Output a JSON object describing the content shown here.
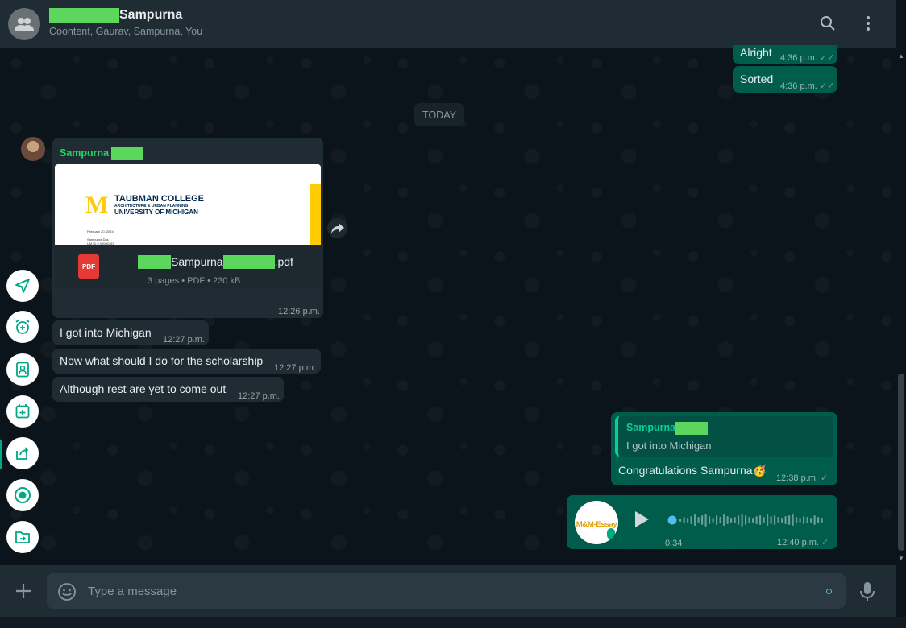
{
  "header": {
    "title": "Sampurna",
    "members": "Coontent, Gaurav, Sampurna, You"
  },
  "messages": {
    "out_prev_1": {
      "text": "Alright",
      "time": "4:36 p.m."
    },
    "out_prev_2": {
      "text": "Sorted",
      "time": "4:36 p.m."
    },
    "date_divider": "TODAY",
    "doc_message": {
      "sender": "Sampurna",
      "preview": {
        "college_line1": "TAUBMAN COLLEGE",
        "college_line2": "ARCHITECTURE & URBAN PLANNING",
        "college_line3": "UNIVERSITY OF MICHIGAN",
        "date_line": "February 20, 2024",
        "name_line": "Sampurna Das",
        "id_line": "UM ID # 00000763"
      },
      "pdf_label": "PDF",
      "file_name_mid": "Sampurna",
      "file_ext": ".pdf",
      "file_meta": "3 pages • PDF • 230 kB",
      "time": "12:26 p.m."
    },
    "in_1": {
      "text": "I got into Michigan",
      "time": "12:27 p.m."
    },
    "in_2": {
      "text": "Now what should I do for the scholarship",
      "time": "12:27 p.m."
    },
    "in_3": {
      "text": "Although rest are yet to come out",
      "time": "12:27 p.m."
    },
    "reply": {
      "quoted_sender": "Sampurna",
      "quoted_text": "I got into Michigan",
      "text": "Congratulations Sampurna🥳",
      "time": "12:38 p.m."
    },
    "voice": {
      "avatar_text": "M&M-Essay",
      "duration": "0:34",
      "time": "12:40 p.m."
    }
  },
  "composer": {
    "placeholder": "Type a message"
  },
  "colors": {
    "accent": "#00a884",
    "outgoing_bubble": "#005c4b",
    "incoming_bubble": "#202c33",
    "header": "#202c33",
    "redaction": "#5cd65c"
  },
  "icons": {
    "header": [
      "group-avatar-icon",
      "search-icon",
      "menu-dots-icon"
    ],
    "side": [
      "send-location-icon",
      "add-alarm-icon",
      "contact-icon",
      "calendar-add-icon",
      "share-icon",
      "status-icon",
      "folder-icon"
    ],
    "composer": [
      "plus-icon",
      "emoji-icon",
      "mic-icon"
    ]
  }
}
